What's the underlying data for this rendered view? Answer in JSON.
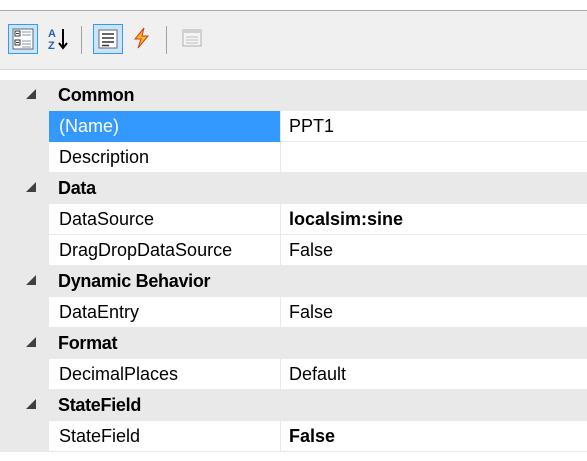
{
  "toolbar": {
    "buttons": [
      {
        "icon": "categorized-icon",
        "active": true
      },
      {
        "icon": "alphabetical-icon",
        "active": false
      },
      {
        "icon": "properties-icon",
        "active": true
      },
      {
        "icon": "events-icon",
        "active": false
      },
      {
        "icon": "property-pages-icon",
        "active": false
      }
    ]
  },
  "grid": {
    "categories": [
      {
        "label": "Common",
        "properties": [
          {
            "name": "(Name)",
            "value": "PPT1",
            "selected": true,
            "bold": false
          },
          {
            "name": "Description",
            "value": "",
            "selected": false,
            "bold": false
          }
        ]
      },
      {
        "label": "Data",
        "properties": [
          {
            "name": "DataSource",
            "value": "localsim:sine",
            "selected": false,
            "bold": true
          },
          {
            "name": "DragDropDataSource",
            "value": "False",
            "selected": false,
            "bold": false
          }
        ]
      },
      {
        "label": "Dynamic Behavior",
        "properties": [
          {
            "name": "DataEntry",
            "value": "False",
            "selected": false,
            "bold": false
          }
        ]
      },
      {
        "label": "Format",
        "properties": [
          {
            "name": "DecimalPlaces",
            "value": "Default",
            "selected": false,
            "bold": false
          }
        ]
      },
      {
        "label": "StateField",
        "properties": [
          {
            "name": "StateField",
            "value": "False",
            "selected": false,
            "bold": true
          }
        ]
      }
    ]
  },
  "colors": {
    "selection": "#3399ff",
    "category_bg": "#e9e9e9",
    "toolbar_bg": "#f0f0f0",
    "active_button_border": "#3399ff"
  }
}
